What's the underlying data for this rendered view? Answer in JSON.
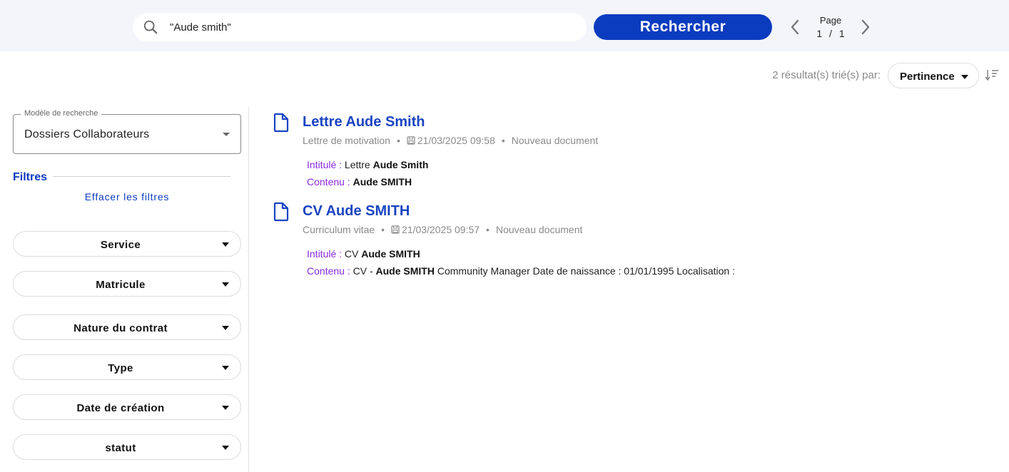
{
  "search": {
    "query": "\"Aude smith\"",
    "button_label": "Rechercher"
  },
  "pagination": {
    "label": "Page",
    "current": "1",
    "separator": "/",
    "total": "1"
  },
  "results_header": {
    "count_text": "2 résultat(s) trié(s) par:",
    "sort_value": "Pertinence"
  },
  "sidebar": {
    "model_label": "Modèle de recherche",
    "model_value": "Dossiers Collaborateurs",
    "filters_title": "Filtres",
    "clear_filters": "Effacer les filtres",
    "facets": [
      "Service",
      "Matricule",
      "Nature du contrat",
      "Type",
      "Date de création",
      "statut"
    ]
  },
  "results": [
    {
      "title": "Lettre Aude Smith",
      "doc_type": "Lettre de motivation",
      "date": "21/03/2025 09:58",
      "status": "Nouveau document",
      "intitule_key": "Intitulé :",
      "intitule_pre": "Lettre",
      "intitule_hl": "Aude Smith",
      "contenu_key": "Contenu :",
      "contenu_pre": "",
      "contenu_hl": "Aude SMITH",
      "contenu_post": ""
    },
    {
      "title": "CV Aude SMITH",
      "doc_type": "Curriculum vitae",
      "date": "21/03/2025 09:57",
      "status": "Nouveau document",
      "intitule_key": "Intitulé :",
      "intitule_pre": "CV",
      "intitule_hl": "Aude SMITH",
      "contenu_key": "Contenu :",
      "contenu_pre": "CV -",
      "contenu_hl": "Aude SMITH",
      "contenu_post": "Community Manager Date de naissance : 01/01/1995 Localisation :"
    }
  ],
  "colors": {
    "primary": "#0b3bbf",
    "link": "#1a44c2",
    "field_key": "#8a2be2",
    "muted": "#8a8a8a",
    "topbar_bg": "#f3f5fb"
  },
  "icons": [
    "search-icon",
    "chevron-left-icon",
    "chevron-right-icon",
    "sort-icon",
    "document-icon",
    "save-icon",
    "caret-down-icon"
  ]
}
